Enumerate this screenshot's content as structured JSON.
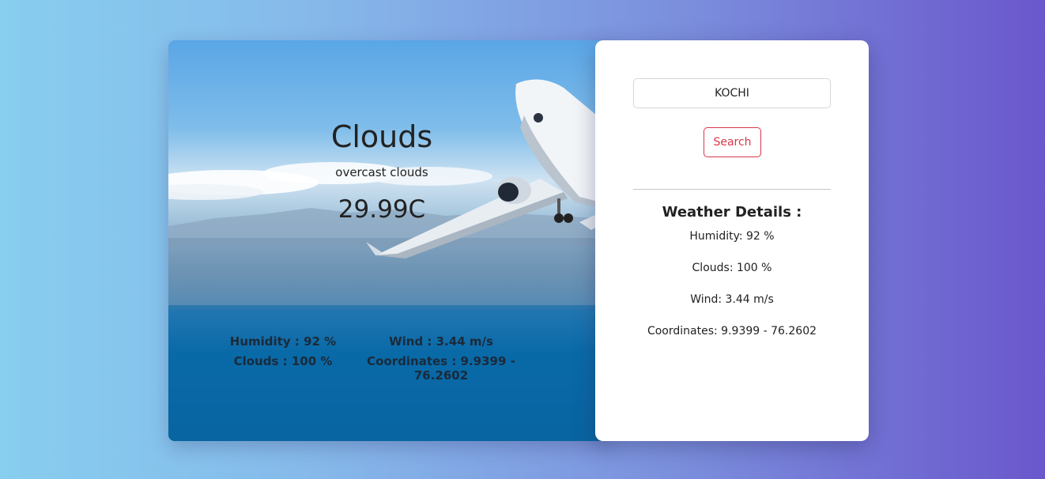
{
  "hero": {
    "condition": "Clouds",
    "description": "overcast clouds",
    "temperature": "29.99C",
    "stats": {
      "humidity": "Humidity : 92 %",
      "wind": "Wind : 3.44 m/s",
      "clouds": "Clouds : 100 %",
      "coordinates": "Coordinates : 9.9399 - 76.2602"
    }
  },
  "panel": {
    "search_value": "KOCHI",
    "search_button": "Search",
    "details_title": "Weather Details :",
    "details": {
      "humidity": "Humidity: 92 %",
      "clouds": "Clouds: 100 %",
      "wind": "Wind: 3.44 m/s",
      "coordinates": "Coordinates: 9.9399 - 76.2602"
    }
  },
  "colors": {
    "accent": "#d9374b",
    "bg_start": "#87ceef",
    "bg_end": "#6a57cc"
  }
}
